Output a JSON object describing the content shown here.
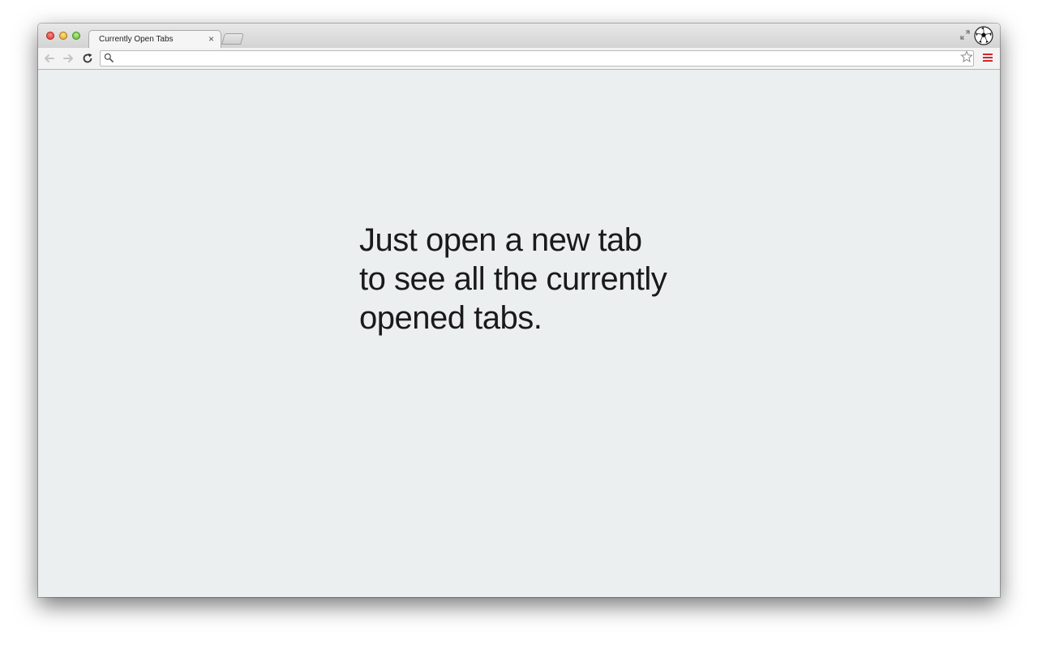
{
  "browser": {
    "tab": {
      "title": "Currently Open Tabs",
      "close_glyph": "×"
    },
    "omnibox": {
      "value": "",
      "placeholder": ""
    },
    "icons": {
      "back": "back-arrow-icon",
      "forward": "forward-arrow-icon",
      "reload": "reload-icon",
      "search": "search-icon",
      "bookmark": "star-icon",
      "menu": "hamburger-menu-icon",
      "fullscreen": "fullscreen-icon",
      "profile": "soccer-ball-avatar-icon"
    },
    "colors": {
      "page_background": "#eceff0",
      "menu_accent": "#d2272b",
      "close_red": "#d9342b",
      "minimize_yellow": "#e0a21c",
      "zoom_green": "#5fb336"
    }
  },
  "page": {
    "message_lines": [
      "Just open a new tab",
      "to see all the currently",
      "opened tabs."
    ]
  }
}
